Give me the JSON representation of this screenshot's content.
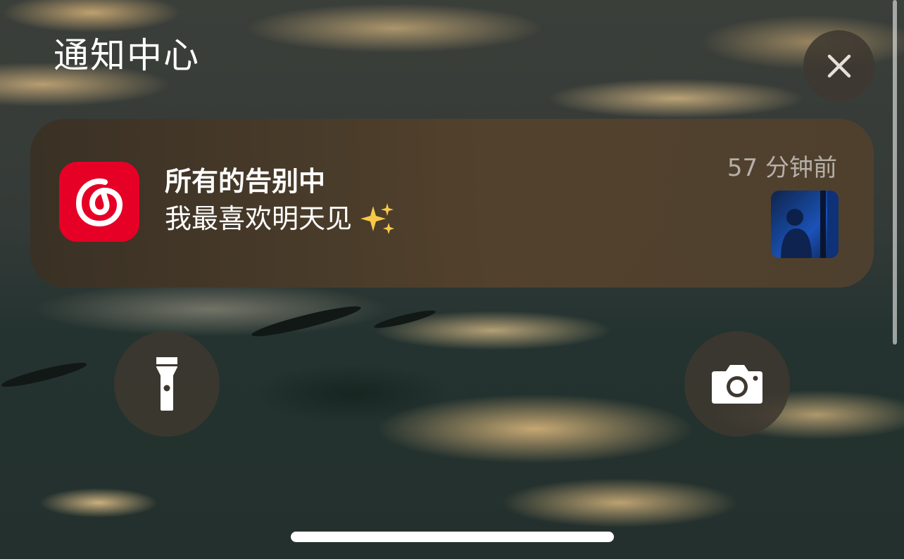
{
  "header": {
    "title": "通知中心"
  },
  "notification": {
    "app_icon": "netease-cloud-music-icon",
    "title": "所有的告别中",
    "body": "我最喜欢明天见",
    "body_emoji": "sparkles-icon",
    "time": "57 分钟前",
    "thumbnail": "album-art-thumbnail"
  },
  "controls": {
    "close_icon": "close-icon",
    "flashlight_icon": "flashlight-icon",
    "camera_icon": "camera-icon"
  },
  "colors": {
    "app_icon_red": "#e60026",
    "notification_bg": "#4a3a28",
    "button_bg": "#3e3830"
  }
}
